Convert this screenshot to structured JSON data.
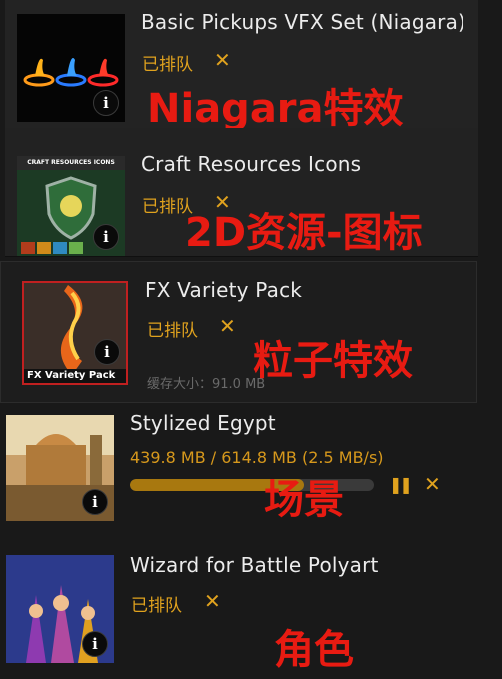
{
  "items": [
    {
      "title": "Basic Pickups VFX Set (Niagara)",
      "status": "已排队",
      "close_glyph": "✕",
      "info_glyph": "i",
      "overlay": "Niagara特效"
    },
    {
      "title": "Craft Resources Icons",
      "status": "已排队",
      "close_glyph": "✕",
      "info_glyph": "i",
      "thumb_caption": "CRAFT RESOURCES ICONS",
      "overlay": "2D资源-图标"
    },
    {
      "title": "FX Variety Pack",
      "status": "已排队",
      "close_glyph": "✕",
      "info_glyph": "i",
      "thumb_caption": "FX Variety Pack",
      "cache_size": "缓存大小：91.0 MB",
      "overlay": "粒子特效"
    },
    {
      "title": "Stylized Egypt",
      "progress_text": "439.8 MB / 614.8 MB (2.5 MB/s)",
      "progress_fraction": 0.715,
      "pause_glyph": "❚❚",
      "close_glyph": "✕",
      "info_glyph": "i",
      "overlay": "场景"
    },
    {
      "title": "Wizard for Battle Polyart",
      "status": "已排队",
      "close_glyph": "✕",
      "info_glyph": "i",
      "overlay": "角色"
    }
  ],
  "colors": {
    "accent": "#e0a21e",
    "overlay_text": "#e81b12",
    "background": "#191919"
  }
}
